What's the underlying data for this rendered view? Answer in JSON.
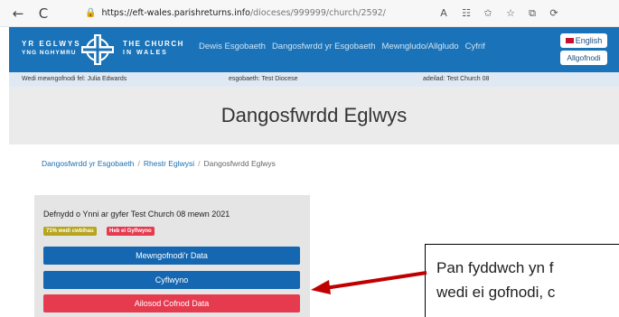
{
  "browser": {
    "url_host": "https://eft-wales.parishreturns.info",
    "url_path": "/dioceses/999999/church/2592/",
    "nav_back": "←",
    "nav_refresh": "C",
    "lock_icon": "lock-icon",
    "toolbar_icons": [
      "A",
      "☷",
      "✩",
      "☆",
      "⧉",
      "⟳"
    ]
  },
  "header": {
    "logo_left_line1": "YR EGLWYS",
    "logo_left_line2": "YNG NGHYMRU",
    "logo_right_line1": "THE CHURCH",
    "logo_right_line2": "IN WALES",
    "nav": [
      "Dewis Esgobaeth",
      "Dangosfwrdd yr Esgobaeth",
      "Mewngludo/Allgludo",
      "Cyfrif"
    ],
    "english_label": "English",
    "logout_label": "Allgofnodi",
    "brand_color": "#1a73b8"
  },
  "info_bar": {
    "logged_in": "Wedi mewngofnodi fel: Julia Edwards",
    "diocese": "esgobaeth: Test Diocese",
    "building": "adeilad: Test Church 08"
  },
  "page": {
    "title": "Dangosfwrdd Eglwys"
  },
  "breadcrumb": {
    "items": [
      "Dangosfwrdd yr Esgobaeth",
      "Rhestr Eglwysi",
      "Dangosfwrdd Eglwys"
    ],
    "separator": "/"
  },
  "card": {
    "title": "Defnydd o Ynni ar gyfer Test Church 08 mewn 2021",
    "progress_badge": "71% wedi cwblhau",
    "progress_value": 71,
    "status_badge": "Heb ei Gyflwyno",
    "record_button": "Mewngofnodi'r Data",
    "submit_button": "Cyflwyno",
    "delete_button": "Ailosod Cofnod Data",
    "colors": {
      "primary": "#1567b1",
      "danger": "#e63a4f",
      "progress": "#b7a51d"
    }
  },
  "callout": {
    "line1": "Pan fyddwch yn f",
    "line2": "wedi ei gofnodi, c"
  }
}
